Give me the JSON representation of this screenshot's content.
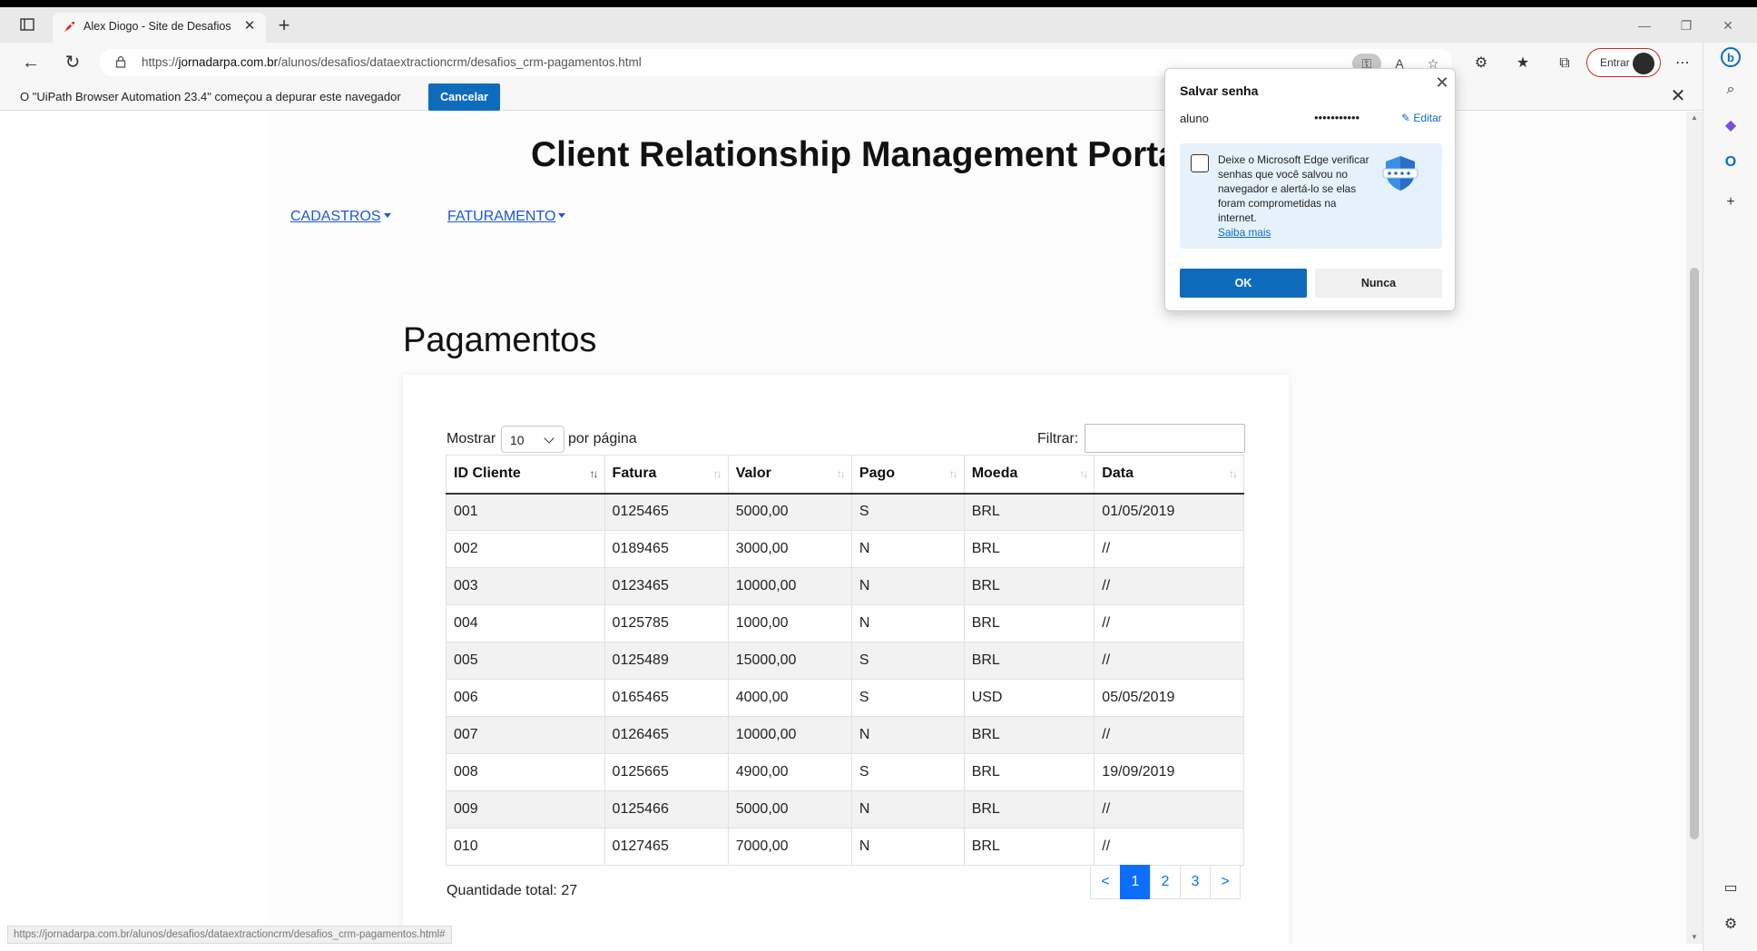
{
  "browser": {
    "tab_title": "Alex Diogo - Site de Desafios RPA",
    "url_prefix": "https://",
    "url_host": "jornadarpa.com.br",
    "url_path": "/alunos/desafios/dataextractioncrm/desafios_crm-pagamentos.html",
    "signin_label": "Entrar",
    "status_url": "https://jornadarpa.com.br/alunos/desafios/dataextractioncrm/desafios_crm-pagamentos.html#"
  },
  "infobar": {
    "message": "O \"UiPath Browser Automation 23.4\" começou a depurar este navegador",
    "cancel_label": "Cancelar"
  },
  "page": {
    "portal_title": "Client Relationship Management Portal",
    "menu": [
      {
        "label": "CADASTROS"
      },
      {
        "label": "FATURAMENTO"
      }
    ],
    "heading": "Pagamentos",
    "show_label": "Mostrar",
    "show_value": "10",
    "per_page_label": "por página",
    "filter_label": "Filtrar:",
    "filter_value": "",
    "columns": [
      "ID Cliente",
      "Fatura",
      "Valor",
      "Pago",
      "Moeda",
      "Data"
    ],
    "rows": [
      [
        "001",
        "0125465",
        "5000,00",
        "S",
        "BRL",
        "01/05/2019"
      ],
      [
        "002",
        "0189465",
        "3000,00",
        "N",
        "BRL",
        "//"
      ],
      [
        "003",
        "0123465",
        "10000,00",
        "N",
        "BRL",
        "//"
      ],
      [
        "004",
        "0125785",
        "1000,00",
        "N",
        "BRL",
        "//"
      ],
      [
        "005",
        "0125489",
        "15000,00",
        "S",
        "BRL",
        "//"
      ],
      [
        "006",
        "0165465",
        "4000,00",
        "S",
        "USD",
        "05/05/2019"
      ],
      [
        "007",
        "0126465",
        "10000,00",
        "N",
        "BRL",
        "//"
      ],
      [
        "008",
        "0125665",
        "4900,00",
        "S",
        "BRL",
        "19/09/2019"
      ],
      [
        "009",
        "0125466",
        "5000,00",
        "N",
        "BRL",
        "//"
      ],
      [
        "010",
        "0127465",
        "7000,00",
        "N",
        "BRL",
        "//"
      ]
    ],
    "total_label": "Quantidade total: 27",
    "pagination": {
      "prev": "<",
      "pages": [
        "1",
        "2",
        "3"
      ],
      "active_page": "1",
      "next": ">"
    }
  },
  "password_popup": {
    "title": "Salvar senha",
    "username": "aluno",
    "password_mask": "•••••••••••",
    "edit_label": "Editar",
    "check_text": "Deixe o Microsoft Edge verificar senhas que você salvou no navegador e alertá-lo se elas foram comprometidas na internet.",
    "learn_more": "Saiba mais",
    "ok_label": "OK",
    "never_label": "Nunca"
  },
  "colors": {
    "accent": "#0f6cbd",
    "link": "#1a56db",
    "pagination_active": "#0d6efd"
  }
}
